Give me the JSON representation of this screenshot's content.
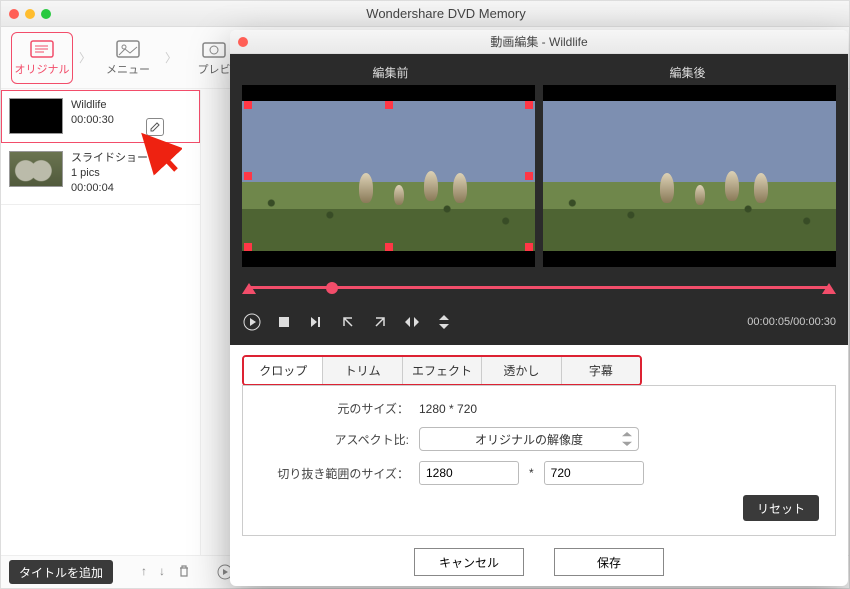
{
  "app": {
    "title": "Wondershare DVD Memory"
  },
  "nav": {
    "items": [
      {
        "label": "オリジナル"
      },
      {
        "label": "メニュー"
      },
      {
        "label": "プレビ"
      }
    ]
  },
  "sidebar": {
    "items": [
      {
        "title": "Wildlife",
        "duration": "00:00:30"
      },
      {
        "title": "スライドショー",
        "detail": "1 pics",
        "duration": "00:00:04"
      }
    ]
  },
  "footer": {
    "add_title_label": "タイトルを追加"
  },
  "dialog": {
    "title": "動画編集 - Wildlife",
    "preview": {
      "before_label": "編集前",
      "after_label": "編集後"
    },
    "timecode": "00:00:05/00:00:30",
    "tabs": [
      {
        "label": "クロップ"
      },
      {
        "label": "トリム"
      },
      {
        "label": "エフェクト"
      },
      {
        "label": "透かし"
      },
      {
        "label": "字幕"
      }
    ],
    "crop": {
      "original_size_label": "元のサイズ：",
      "original_size_value": "1280 * 720",
      "aspect_label": "アスペクト比:",
      "aspect_value": "オリジナルの解像度",
      "crop_size_label": "切り抜き範囲のサイズ：",
      "crop_w": "1280",
      "crop_sep": "*",
      "crop_h": "720",
      "reset_label": "リセット"
    },
    "buttons": {
      "cancel": "キャンセル",
      "save": "保存"
    }
  }
}
